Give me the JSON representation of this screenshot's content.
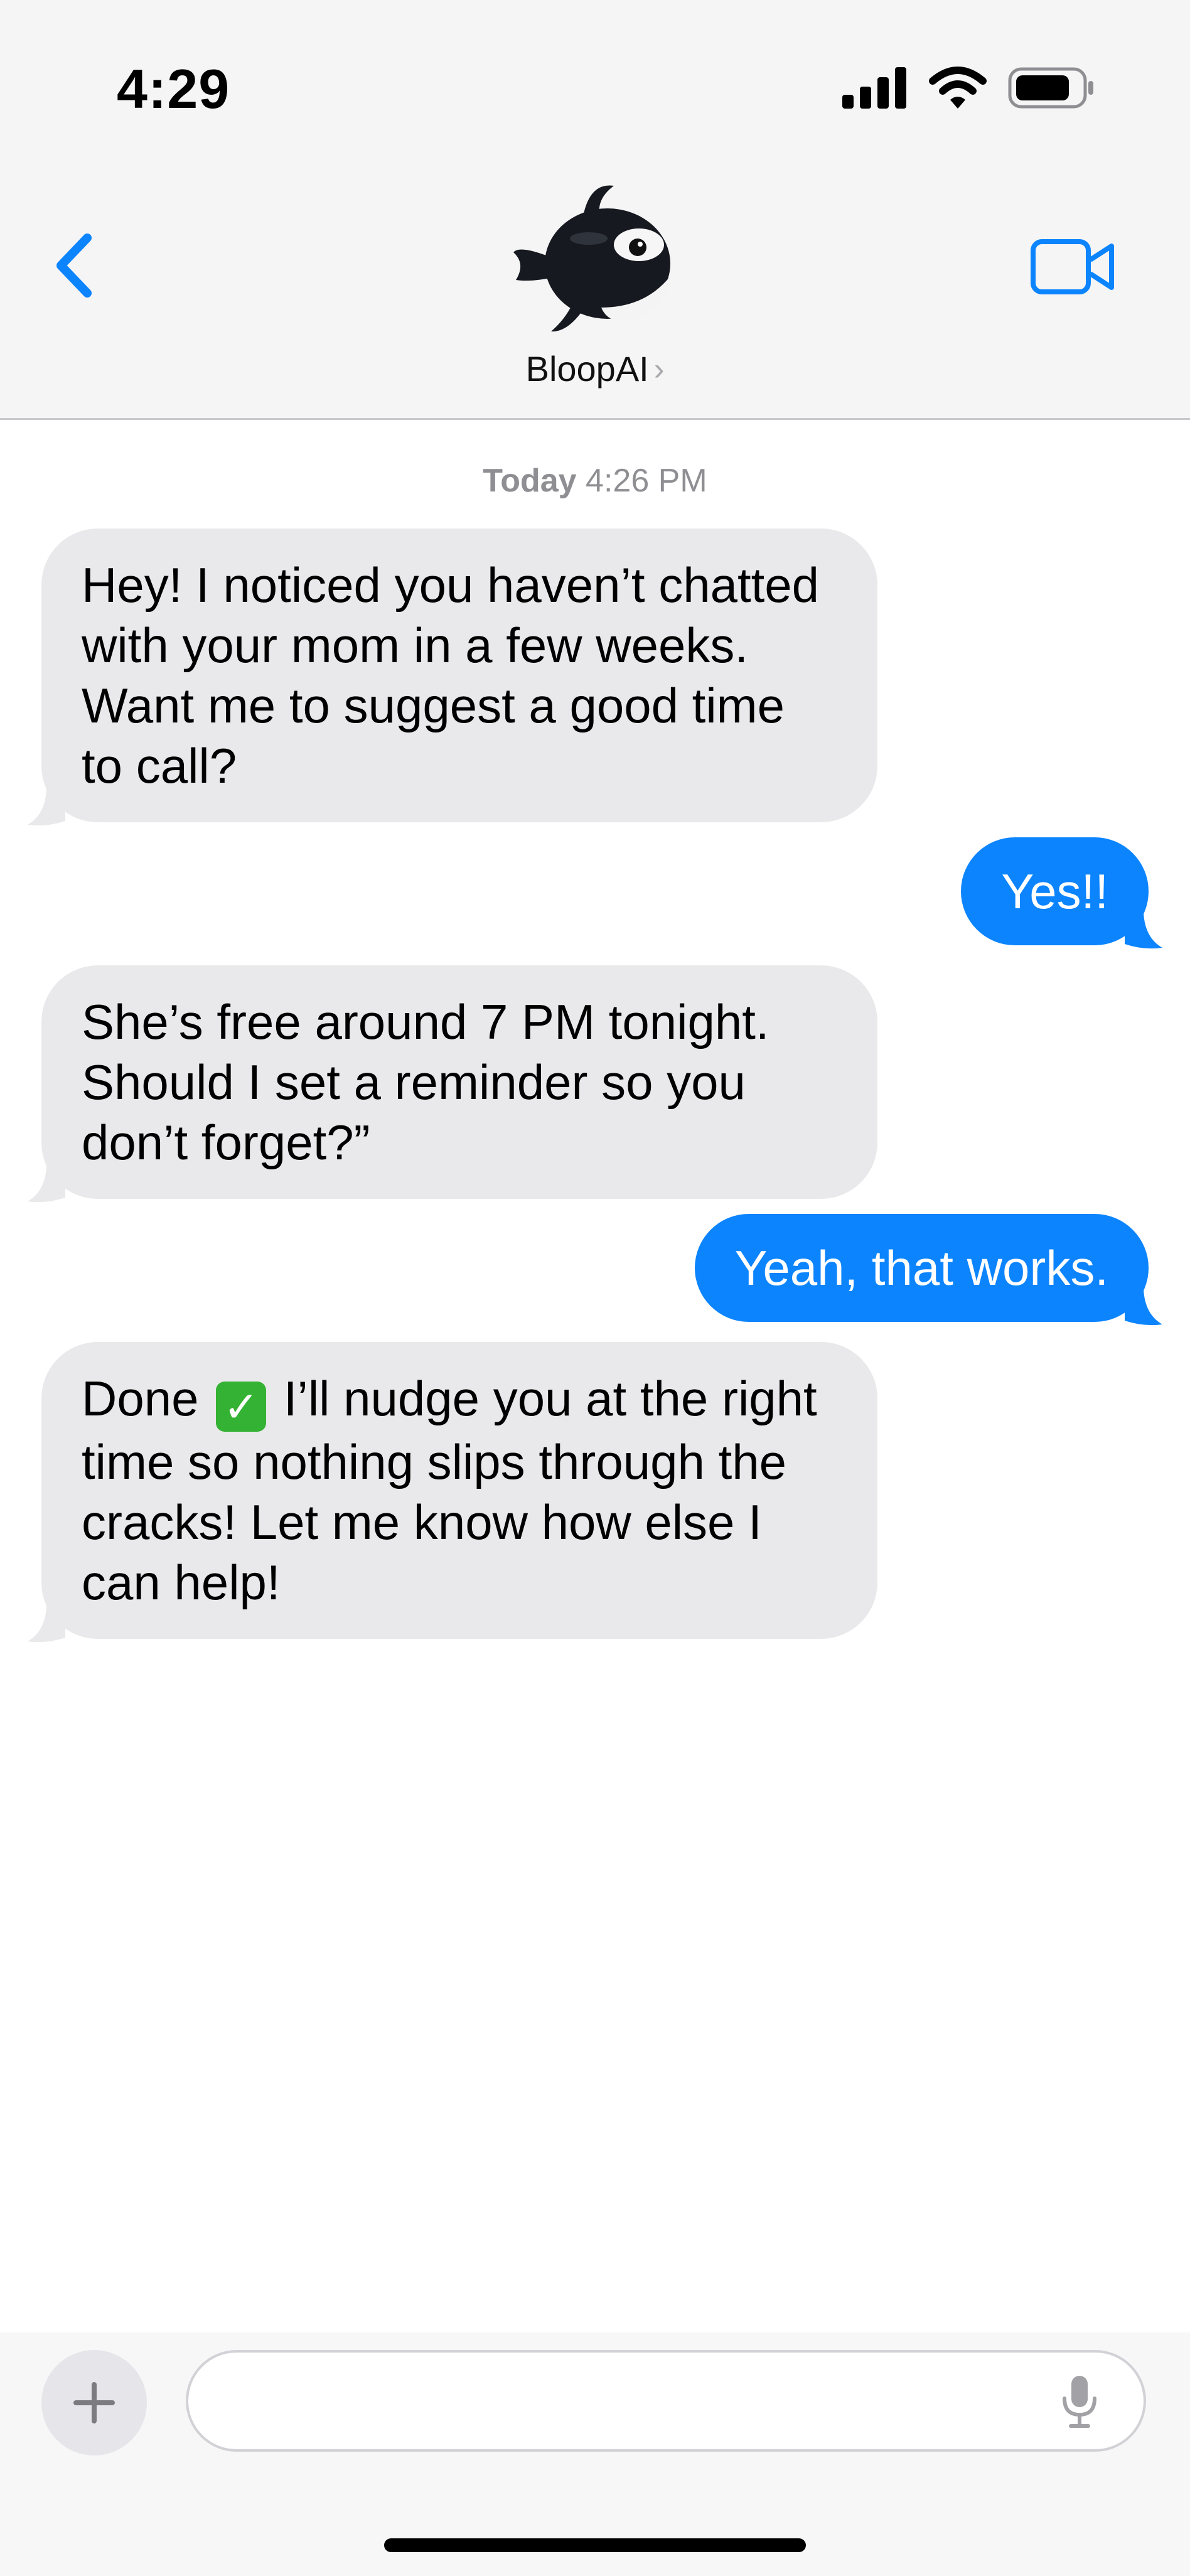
{
  "status_bar": {
    "time": "4:29"
  },
  "header": {
    "contact_name": "BloopAI",
    "chevron": "›",
    "back_icon": "chevron-left-icon",
    "video_icon": "video-camera-icon",
    "avatar": "orca-avatar"
  },
  "conversation": {
    "timestamp_day": "Today",
    "timestamp_time": "4:26 PM",
    "messages": [
      {
        "sender": "BloopAI",
        "direction": "incoming",
        "text": "Hey! I noticed you haven’t chatted with your mom in a few weeks. Want me to suggest a good time to call?"
      },
      {
        "sender": "me",
        "direction": "outgoing",
        "text": "Yes!!"
      },
      {
        "sender": "BloopAI",
        "direction": "incoming",
        "text": "She’s free around 7 PM tonight. Should I set a reminder so you don’t forget?”"
      },
      {
        "sender": "me",
        "direction": "outgoing",
        "text": "Yeah, that works."
      },
      {
        "sender": "BloopAI",
        "direction": "incoming",
        "text_before_emoji": "Done",
        "emoji": "✓",
        "text_after_emoji": "I’ll nudge you at the right time so nothing slips through the cracks! Let me know how else I can help!"
      }
    ]
  },
  "composer": {
    "value": "",
    "placeholder": "",
    "plus_icon": "plus-icon",
    "mic_icon": "microphone-icon"
  },
  "colors": {
    "accent": "#0b84fe",
    "incoming_bubble": "#e9e9eb",
    "header_bg": "#f5f5f5",
    "timestamp": "#8e8e93"
  }
}
